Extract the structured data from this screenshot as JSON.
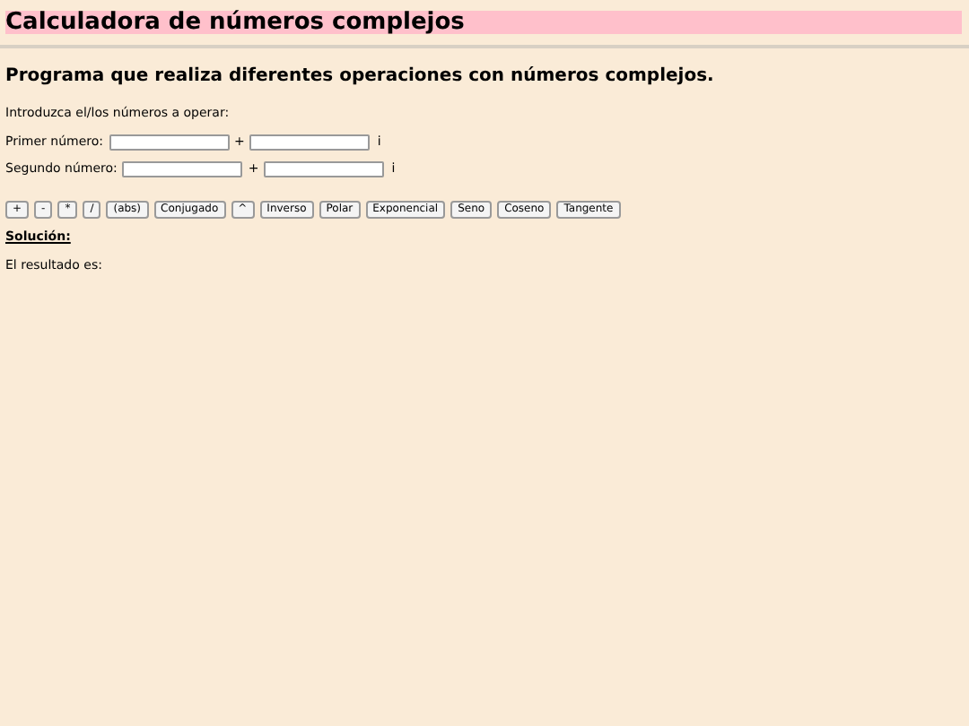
{
  "title": "Calculadora de números complejos",
  "subtitle": "Programa que realiza diferentes operaciones con números complejos.",
  "intro": "Introduzca el/los números a operar:",
  "inputs": [
    {
      "label": "Primer número:",
      "plus": "+",
      "i": "i"
    },
    {
      "label": "Segundo número:",
      "plus": "+",
      "i": "i"
    }
  ],
  "buttons": [
    "+",
    "-",
    "*",
    "/",
    "(abs)",
    "Conjugado",
    "^",
    "Inverso",
    "Polar",
    "Exponencial",
    "Seno",
    "Coseno",
    "Tangente"
  ],
  "solution_heading": "Solución:",
  "result": "El resultado es:"
}
